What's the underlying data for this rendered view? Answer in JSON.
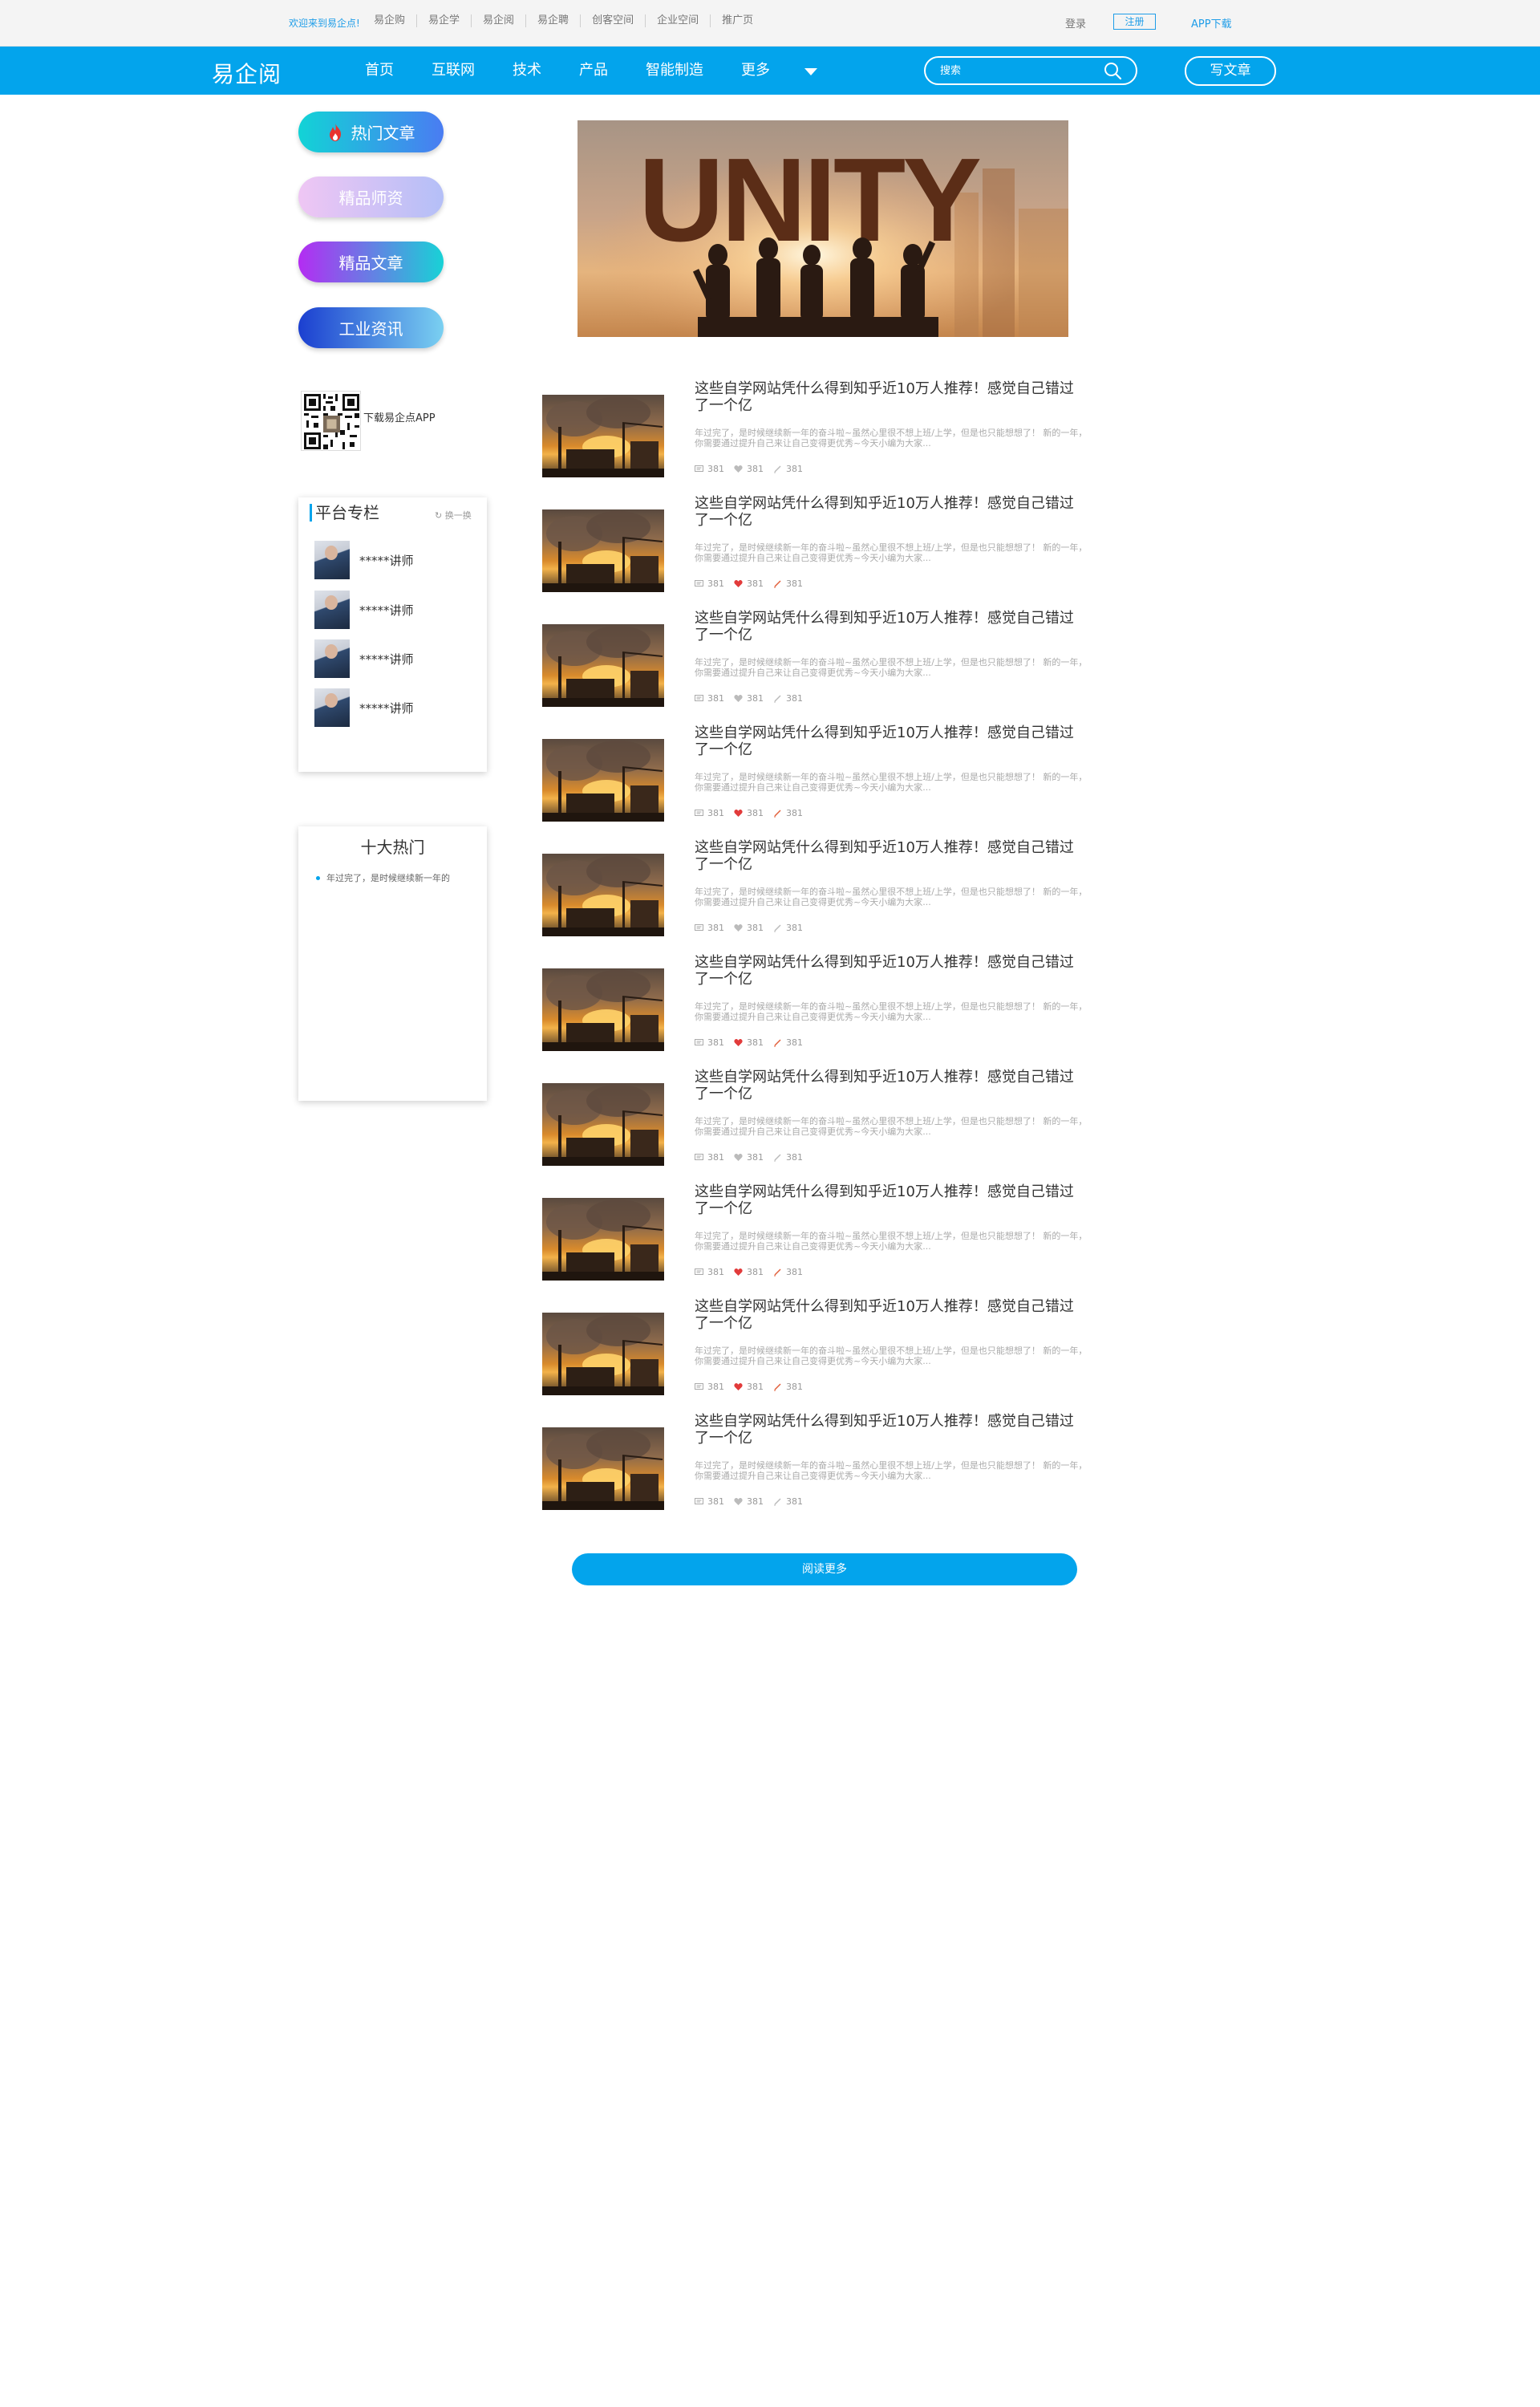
{
  "topbar": {
    "welcome": "欢迎来到易企点!",
    "links": [
      "易企购",
      "易企学",
      "易企阅",
      "易企聘",
      "创客空间",
      "企业空间",
      "推广页"
    ],
    "login": "登录",
    "register": "注册",
    "app_download": "APP下载"
  },
  "nav": {
    "logo": "易企阅",
    "items": [
      "首页",
      "互联网",
      "技术",
      "产品",
      "智能制造",
      "更多"
    ],
    "search_placeholder": "搜索",
    "write_button": "写文章"
  },
  "sidebar": {
    "pills": [
      "热门文章",
      "精品师资",
      "精品文章",
      "工业资讯"
    ],
    "qr_label": "下载易企点APP",
    "platform": {
      "title": "平台专栏",
      "switch_label": "换一换",
      "teachers": [
        "*****讲师",
        "*****讲师",
        "*****讲师",
        "*****讲师"
      ]
    },
    "hot": {
      "title": "十大热门",
      "items": [
        "年过完了，是时候继续新一年的"
      ]
    }
  },
  "banner": {
    "text": "UNITY"
  },
  "articles": [
    {
      "title": "这些自学网站凭什么得到知乎近10万人推荐！感觉自己错过了一个亿",
      "desc": "年过完了，是时候继续新一年的奋斗啦~虽然心里很不想上班/上学，但是也只能想想了！ 新的一年，你需要通过提升自己来让自己变得更优秀~今天小编为大家...",
      "views": "381",
      "likes": "381",
      "comments": "381",
      "liked": false
    },
    {
      "title": "这些自学网站凭什么得到知乎近10万人推荐！感觉自己错过了一个亿",
      "desc": "年过完了，是时候继续新一年的奋斗啦~虽然心里很不想上班/上学，但是也只能想想了！ 新的一年，你需要通过提升自己来让自己变得更优秀~今天小编为大家...",
      "views": "381",
      "likes": "381",
      "comments": "381",
      "liked": true
    },
    {
      "title": "这些自学网站凭什么得到知乎近10万人推荐！感觉自己错过了一个亿",
      "desc": "年过完了，是时候继续新一年的奋斗啦~虽然心里很不想上班/上学，但是也只能想想了！ 新的一年，你需要通过提升自己来让自己变得更优秀~今天小编为大家...",
      "views": "381",
      "likes": "381",
      "comments": "381",
      "liked": false
    },
    {
      "title": "这些自学网站凭什么得到知乎近10万人推荐！感觉自己错过了一个亿",
      "desc": "年过完了，是时候继续新一年的奋斗啦~虽然心里很不想上班/上学，但是也只能想想了！ 新的一年，你需要通过提升自己来让自己变得更优秀~今天小编为大家...",
      "views": "381",
      "likes": "381",
      "comments": "381",
      "liked": true
    },
    {
      "title": "这些自学网站凭什么得到知乎近10万人推荐！感觉自己错过了一个亿",
      "desc": "年过完了，是时候继续新一年的奋斗啦~虽然心里很不想上班/上学，但是也只能想想了！ 新的一年，你需要通过提升自己来让自己变得更优秀~今天小编为大家...",
      "views": "381",
      "likes": "381",
      "comments": "381",
      "liked": false
    },
    {
      "title": "这些自学网站凭什么得到知乎近10万人推荐！感觉自己错过了一个亿",
      "desc": "年过完了，是时候继续新一年的奋斗啦~虽然心里很不想上班/上学，但是也只能想想了！ 新的一年，你需要通过提升自己来让自己变得更优秀~今天小编为大家...",
      "views": "381",
      "likes": "381",
      "comments": "381",
      "liked": true
    },
    {
      "title": "这些自学网站凭什么得到知乎近10万人推荐！感觉自己错过了一个亿",
      "desc": "年过完了，是时候继续新一年的奋斗啦~虽然心里很不想上班/上学，但是也只能想想了！ 新的一年，你需要通过提升自己来让自己变得更优秀~今天小编为大家...",
      "views": "381",
      "likes": "381",
      "comments": "381",
      "liked": false
    },
    {
      "title": "这些自学网站凭什么得到知乎近10万人推荐！感觉自己错过了一个亿",
      "desc": "年过完了，是时候继续新一年的奋斗啦~虽然心里很不想上班/上学，但是也只能想想了！ 新的一年，你需要通过提升自己来让自己变得更优秀~今天小编为大家...",
      "views": "381",
      "likes": "381",
      "comments": "381",
      "liked": true
    },
    {
      "title": "这些自学网站凭什么得到知乎近10万人推荐！感觉自己错过了一个亿",
      "desc": "年过完了，是时候继续新一年的奋斗啦~虽然心里很不想上班/上学，但是也只能想想了！ 新的一年，你需要通过提升自己来让自己变得更优秀~今天小编为大家...",
      "views": "381",
      "likes": "381",
      "comments": "381",
      "liked": true
    },
    {
      "title": "这些自学网站凭什么得到知乎近10万人推荐！感觉自己错过了一个亿",
      "desc": "年过完了，是时候继续新一年的奋斗啦~虽然心里很不想上班/上学，但是也只能想想了！ 新的一年，你需要通过提升自己来让自己变得更优秀~今天小编为大家...",
      "views": "381",
      "likes": "381",
      "comments": "381",
      "liked": false
    }
  ],
  "read_more": "阅读更多",
  "colors": {
    "brand": "#03a4ec",
    "like": "#e23b3b",
    "comment": "#e2603b"
  }
}
